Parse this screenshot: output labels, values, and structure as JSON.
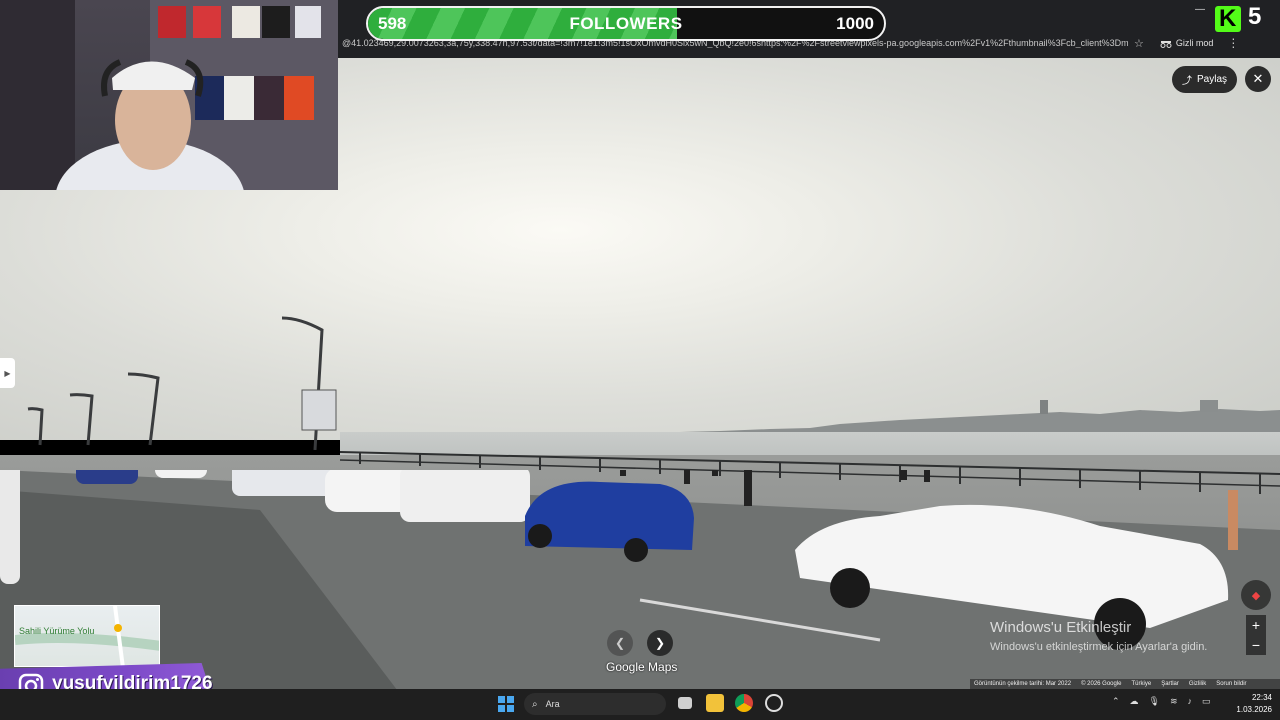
{
  "stream": {
    "follower_goal": {
      "current": "598",
      "label": "FOLLOWERS",
      "target": "1000",
      "progress_fraction": 0.598
    },
    "kick_count": "5",
    "instagram_handle": "yusufyildirim1726"
  },
  "browser": {
    "url": "@41.023469,29.0073263,3a,75y,338.47h,97.53t/data=!3m7!1e1!3m5!1sOxOmvdH0Six5wN_QbQ!2e0!6shttps:%2F%2Fstreetviewpixels-pa.googleapis.com%2Fv1%2Fthumbnail%3Fcb_client%3Dm...",
    "incognito_label": "Gizli mod"
  },
  "streetview": {
    "share_label": "Paylaş",
    "maps_logo": "Google Maps",
    "minimap_label": "Sahili Yürüme Yolu",
    "footer": [
      "Görüntünün çekilme tarihi: Mar 2022",
      "© 2026 Google",
      "Türkiye",
      "Şartlar",
      "Gizlilik",
      "Sorun bildir"
    ]
  },
  "windows_watermark": {
    "title": "Windows'u Etkinleştir",
    "subtitle": "Windows'u etkinleştirmek için Ayarlar'a gidin."
  },
  "taskbar": {
    "search_label": "Ara",
    "time": "22:34",
    "date": "1.03.2026"
  },
  "colors": {
    "follower_fill": "#2fae3d",
    "kick_brand": "#53fc18",
    "instagram_banner": "#7d4ac8",
    "taskbar": "#1f1f1f"
  }
}
